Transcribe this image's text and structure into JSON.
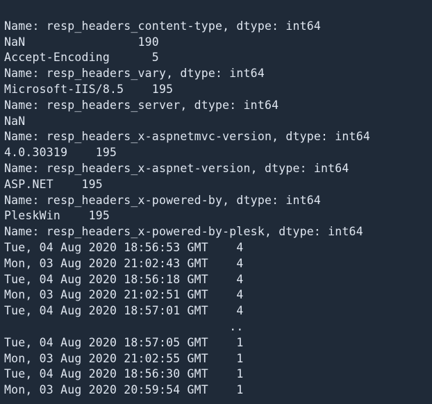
{
  "lines": [
    "Name: resp_headers_content-type, dtype: int64",
    "NaN                190",
    "Accept-Encoding      5",
    "Name: resp_headers_vary, dtype: int64",
    "Microsoft-IIS/8.5    195",
    "Name: resp_headers_server, dtype: int64",
    "NaN",
    "Name: resp_headers_x-aspnetmvc-version, dtype: int64",
    "4.0.30319    195",
    "Name: resp_headers_x-aspnet-version, dtype: int64",
    "ASP.NET    195",
    "Name: resp_headers_x-powered-by, dtype: int64",
    "PleskWin    195",
    "Name: resp_headers_x-powered-by-plesk, dtype: int64",
    "Tue, 04 Aug 2020 18:56:53 GMT    4",
    "Mon, 03 Aug 2020 21:02:43 GMT    4",
    "Tue, 04 Aug 2020 18:56:18 GMT    4",
    "Mon, 03 Aug 2020 21:02:51 GMT    4",
    "Tue, 04 Aug 2020 18:57:01 GMT    4",
    "                                ..",
    "Tue, 04 Aug 2020 18:57:05 GMT    1",
    "Mon, 03 Aug 2020 21:02:55 GMT    1",
    "Tue, 04 Aug 2020 18:56:30 GMT    1",
    "Mon, 03 Aug 2020 20:59:54 GMT    1"
  ]
}
